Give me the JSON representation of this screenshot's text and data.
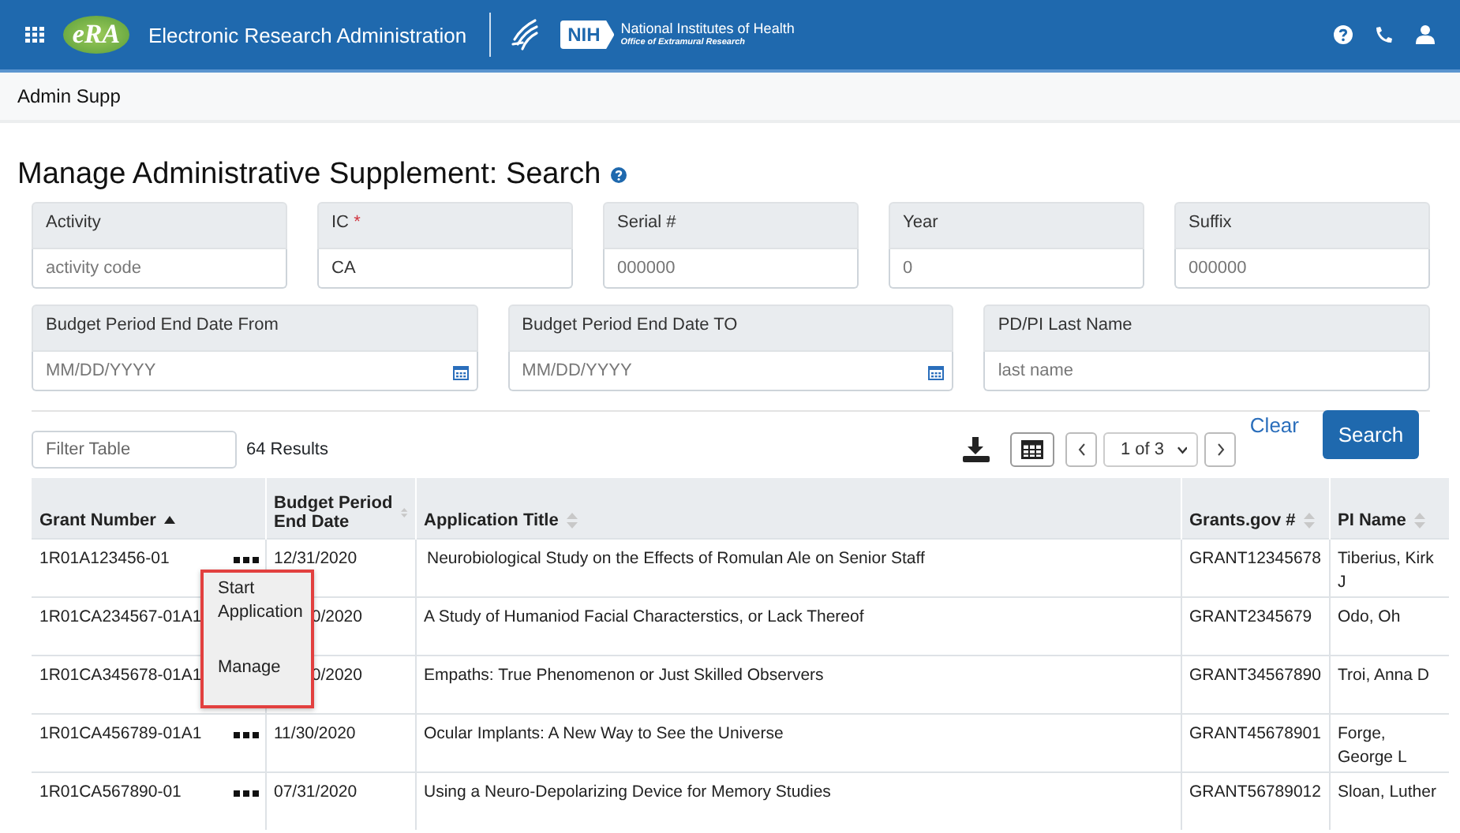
{
  "header": {
    "logo": "eRA",
    "title": "Electronic Research Administration",
    "nih_badge": "NIH",
    "nih_name": "National Institutes of Health",
    "nih_office": "Office of Extramural Research"
  },
  "breadcrumb": "Admin Supp",
  "page_title": "Manage Administrative Supplement: Search",
  "form_rows": [
    [
      {
        "kind": "text",
        "label": "Activity",
        "placeholder": "activity code"
      },
      {
        "kind": "text",
        "label": "IC",
        "required_mark": "*",
        "value": "CA"
      },
      {
        "kind": "text",
        "label": "Serial #",
        "placeholder": "000000"
      },
      {
        "kind": "text",
        "label": "Year",
        "placeholder": "0"
      },
      {
        "kind": "text",
        "label": "Suffix",
        "placeholder": "000000"
      }
    ],
    [
      {
        "kind": "date",
        "label": "Budget Period End Date From",
        "placeholder": "MM/DD/YYYY"
      },
      {
        "kind": "date",
        "label": "Budget Period End Date TO",
        "placeholder": "MM/DD/YYYY"
      },
      {
        "kind": "text",
        "label": "PD/PI Last Name",
        "placeholder": "last name"
      }
    ]
  ],
  "buttons": {
    "clear": "Clear",
    "search": "Search"
  },
  "table": {
    "filter_placeholder": "Filter Table",
    "results": "64 Results",
    "pager": "1 of 3",
    "columns": [
      {
        "label": "Grant Number",
        "sorted_ascending": true
      },
      {
        "label": "Budget Period End Date",
        "sorted_ascending": false
      },
      {
        "label": "Application Title",
        "sorted_ascending": false
      },
      {
        "label": "Grants.gov #",
        "sorted_ascending": false
      },
      {
        "label": "PI Name",
        "sorted_ascending": false
      }
    ],
    "rows": [
      {
        "grant": "1R01A123456-01",
        "covered": false,
        "end_date": "12/31/2020",
        "title": "Neurobiological Study on the Effects of Romulan Ale on Senior Staff",
        "grants_gov": "GRANT12345678",
        "pi": "Tiberius, Kirk J"
      },
      {
        "grant": "1R01CA234567-01A1",
        "covered": true,
        "end_date": "0/2020",
        "title": "A Study of Humaniod Facial Characterstics, or Lack Thereof",
        "grants_gov": "GRANT2345679",
        "pi": "Odo, Oh"
      },
      {
        "grant": "1R01CA345678-01A1",
        "covered": true,
        "end_date": "0/2020",
        "title": "Empaths: True Phenomenon or Just Skilled Observers",
        "grants_gov": "GRANT34567890",
        "pi": "Troi, Anna D"
      },
      {
        "grant": "1R01CA456789-01A1",
        "covered": false,
        "end_date": "11/30/2020",
        "title": "Ocular Implants: A New Way to See the Universe",
        "grants_gov": "GRANT45678901",
        "pi": "Forge, George L"
      },
      {
        "grant": "1R01CA567890-01",
        "covered": false,
        "end_date": "07/31/2020",
        "title": "Using a Neuro-Depolarizing Device for Memory Studies",
        "grants_gov": "GRANT56789012",
        "pi": "Sloan, Luther"
      }
    ],
    "context_menu": [
      "Start Application",
      "Manage"
    ]
  }
}
